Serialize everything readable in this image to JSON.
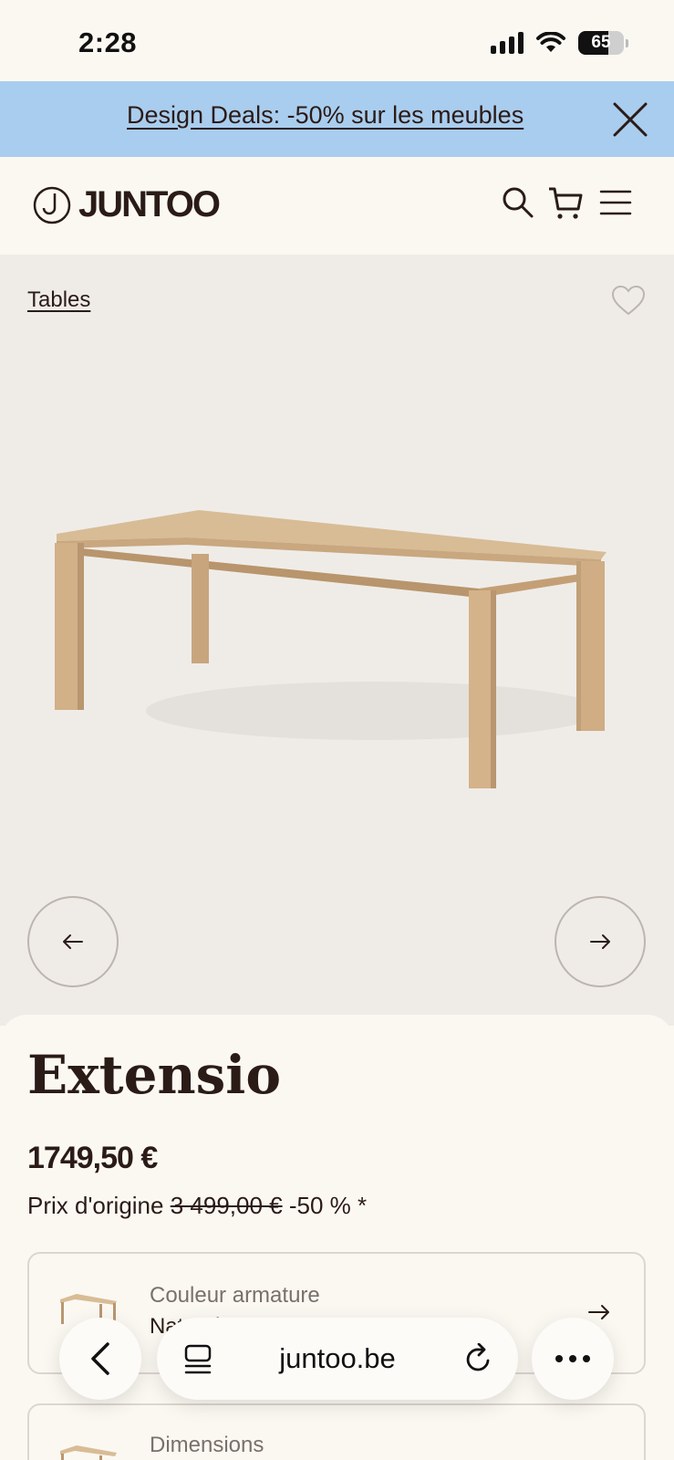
{
  "status_bar": {
    "time": "2:28",
    "battery": "65",
    "battery_level": 0.65
  },
  "promo": {
    "text": "Design Deals: -50% sur les meubles"
  },
  "header": {
    "brand": "JUNTOO",
    "icons": [
      "search-icon",
      "cart-icon",
      "menu-icon"
    ]
  },
  "gallery": {
    "breadcrumb": "Tables",
    "prev_arrow": "←",
    "next_arrow": "→"
  },
  "product": {
    "name": "Extensio",
    "price": "1749,50 €",
    "original_label": "Prix d'origine",
    "original_price": "3 499,00 €",
    "discount": "-50 % *"
  },
  "options": [
    {
      "label": "Couleur armature",
      "value": "Naturel"
    },
    {
      "label": "Dimensions",
      "value": ""
    }
  ],
  "browser": {
    "domain": "juntoo.be"
  },
  "colors": {
    "promo_bg": "#a9cdee",
    "page_bg": "#fbf8f2",
    "gallery_bg": "#efece8",
    "text": "#2b1b17"
  }
}
